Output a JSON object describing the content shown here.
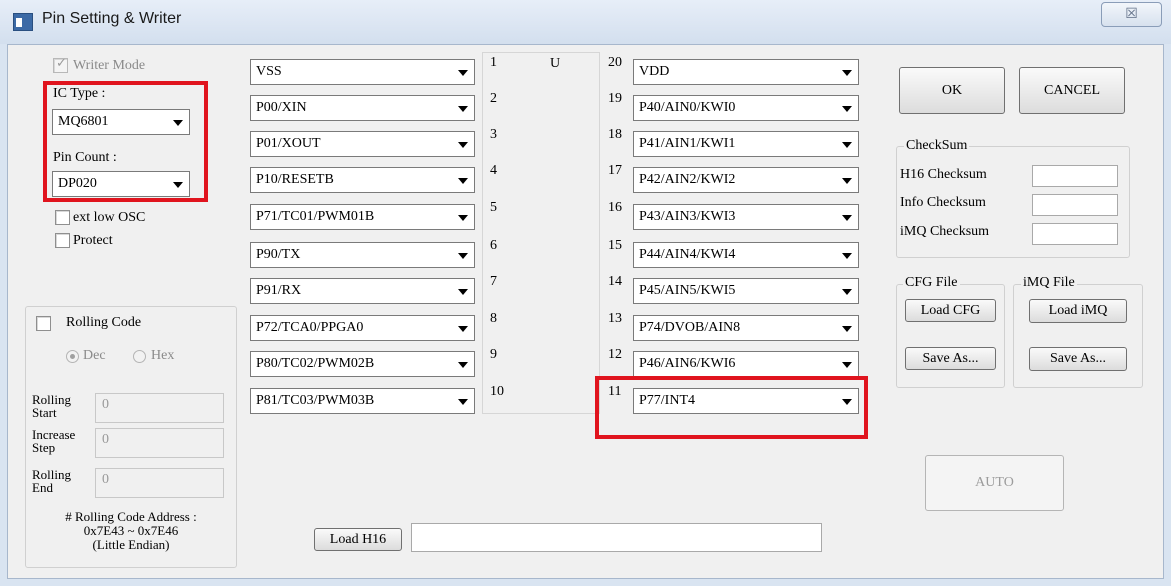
{
  "window": {
    "title": "Pin Setting & Writer",
    "close_glyph": "☒"
  },
  "left": {
    "writer_mode": {
      "label": "Writer Mode",
      "checked": true,
      "enabled": false
    },
    "ic_type": {
      "label": "IC Type :",
      "value": "MQ6801"
    },
    "pin_count": {
      "label": "Pin Count :",
      "value": "DP020"
    },
    "ext_low_osc": {
      "label": "ext low OSC",
      "checked": false
    },
    "protect": {
      "label": "Protect",
      "checked": false
    }
  },
  "rolling": {
    "checkbox_label": "Rolling Code",
    "radio_dec": "Dec",
    "radio_hex": "Hex",
    "start_label_1": "Rolling",
    "start_label_2": "Start",
    "start_value": "0",
    "step_label_1": "Increase",
    "step_label_2": "Step",
    "step_value": "0",
    "end_label_1": "Rolling",
    "end_label_2": "End",
    "end_value": "0",
    "address_line1": "# Rolling Code Address :",
    "address_line2": "0x7E43 ~ 0x7E46",
    "address_line3": "(Little Endian)"
  },
  "chip": {
    "label": "U"
  },
  "pins_left": [
    {
      "num": "1",
      "value": "VSS"
    },
    {
      "num": "2",
      "value": "P00/XIN"
    },
    {
      "num": "3",
      "value": "P01/XOUT"
    },
    {
      "num": "4",
      "value": "P10/RESETB"
    },
    {
      "num": "5",
      "value": "P71/TC01/PWM01B"
    },
    {
      "num": "6",
      "value": "P90/TX"
    },
    {
      "num": "7",
      "value": "P91/RX"
    },
    {
      "num": "8",
      "value": "P72/TCA0/PPGA0"
    },
    {
      "num": "9",
      "value": "P80/TC02/PWM02B"
    },
    {
      "num": "10",
      "value": "P81/TC03/PWM03B"
    }
  ],
  "pins_right": [
    {
      "num": "20",
      "value": "VDD"
    },
    {
      "num": "19",
      "value": "P40/AIN0/KWI0"
    },
    {
      "num": "18",
      "value": "P41/AIN1/KWI1"
    },
    {
      "num": "17",
      "value": "P42/AIN2/KWI2"
    },
    {
      "num": "16",
      "value": "P43/AIN3/KWI3"
    },
    {
      "num": "15",
      "value": "P44/AIN4/KWI4"
    },
    {
      "num": "14",
      "value": "P45/AIN5/KWI5"
    },
    {
      "num": "13",
      "value": "P74/DVOB/AIN8"
    },
    {
      "num": "12",
      "value": "P46/AIN6/KWI6"
    },
    {
      "num": "11",
      "value": "P77/INT4"
    }
  ],
  "bottom": {
    "load_h16_label": "Load H16",
    "h16_path": ""
  },
  "right": {
    "ok_label": "OK",
    "cancel_label": "CANCEL",
    "checksum_title": "CheckSum",
    "h16_checksum_label": "H16 Checksum",
    "info_checksum_label": "Info Checksum",
    "imq_checksum_label": "iMQ Checksum",
    "h16_checksum_value": "",
    "info_checksum_value": "",
    "imq_checksum_value": "",
    "cfg_title": "CFG File",
    "load_cfg_label": "Load CFG",
    "cfg_save_as_label": "Save As...",
    "imq_title": "iMQ File",
    "load_imq_label": "Load iMQ",
    "imq_save_as_label": "Save As...",
    "auto_label": "AUTO"
  },
  "colors": {
    "highlight": "#e0141e",
    "window_frame": "#d9e4f1",
    "client_bg": "#f0f0f0"
  }
}
